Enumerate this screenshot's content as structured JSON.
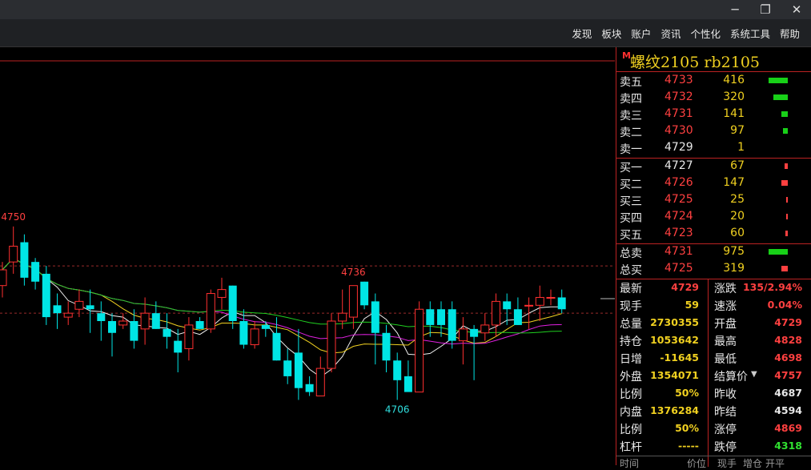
{
  "window": {
    "min_icon": "─",
    "restore_icon": "❐",
    "close_icon": "✕"
  },
  "menu": [
    "发现",
    "板块",
    "账户",
    "资讯",
    "个性化",
    "系统工具",
    "帮助"
  ],
  "instrument": {
    "mark": "M",
    "title": "螺纹2105  rb2105"
  },
  "asks": [
    {
      "label": "卖五",
      "price": "4733",
      "vol": "416",
      "bar": 0.85
    },
    {
      "label": "卖四",
      "price": "4732",
      "vol": "320",
      "bar": 0.65
    },
    {
      "label": "卖三",
      "price": "4731",
      "vol": "141",
      "bar": 0.28
    },
    {
      "label": "卖二",
      "price": "4730",
      "vol": "97",
      "bar": 0.2
    },
    {
      "label": "卖一",
      "price": "4729",
      "vol": "1",
      "bar": 0.0
    }
  ],
  "bids": [
    {
      "label": "买一",
      "price": "4727",
      "vol": "67",
      "bar": 0.14
    },
    {
      "label": "买二",
      "price": "4726",
      "vol": "147",
      "bar": 0.3
    },
    {
      "label": "买三",
      "price": "4725",
      "vol": "25",
      "bar": 0.05
    },
    {
      "label": "买四",
      "price": "4724",
      "vol": "20",
      "bar": 0.04
    },
    {
      "label": "买五",
      "price": "4723",
      "vol": "60",
      "bar": 0.12
    }
  ],
  "totals": [
    {
      "label": "总卖",
      "price": "4731",
      "vol": "975",
      "bar": 0.85,
      "color": "#18d018"
    },
    {
      "label": "总买",
      "price": "4725",
      "vol": "319",
      "bar": 0.28,
      "color": "#ff4040"
    }
  ],
  "stats_left": [
    {
      "label": "最新",
      "value": "4729",
      "color": "#ff4040"
    },
    {
      "label": "现手",
      "value": "59",
      "color": "#f0d020"
    },
    {
      "label": "总量",
      "value": "2730355",
      "color": "#f0d020"
    },
    {
      "label": "持仓",
      "value": "1053642",
      "color": "#f0d020"
    },
    {
      "label": "日增",
      "value": "-11645",
      "color": "#f0d020"
    },
    {
      "label": "外盘",
      "value": "1354071",
      "color": "#f0d020"
    },
    {
      "label": "比例",
      "value": "50%",
      "color": "#f0d020"
    },
    {
      "label": "内盘",
      "value": "1376284",
      "color": "#f0d020"
    },
    {
      "label": "比例",
      "value": "50%",
      "color": "#f0d020"
    },
    {
      "label": "杠杆",
      "value": "-----",
      "color": "#f0d020"
    }
  ],
  "stats_right": [
    {
      "label": "涨跌",
      "value": "135/2.94%",
      "color": "#ff4040"
    },
    {
      "label": "速涨",
      "value": "0.04%",
      "color": "#ff4040"
    },
    {
      "label": "开盘",
      "value": "4729",
      "color": "#ff4040"
    },
    {
      "label": "最高",
      "value": "4828",
      "color": "#ff4040"
    },
    {
      "label": "最低",
      "value": "4698",
      "color": "#ff4040"
    },
    {
      "label": "结算价",
      "value": "4757",
      "color": "#ff4040",
      "dropdown": true
    },
    {
      "label": "昨收",
      "value": "4687",
      "color": "#e8e8e8"
    },
    {
      "label": "昨结",
      "value": "4594",
      "color": "#e8e8e8"
    },
    {
      "label": "涨停",
      "value": "4869",
      "color": "#ff4040"
    },
    {
      "label": "跌停",
      "value": "4318",
      "color": "#30e030"
    }
  ],
  "bottom_header": [
    "时间",
    "价位",
    "现手",
    "增仓",
    "开平"
  ],
  "chart_data": {
    "type": "candlestick",
    "annotations": [
      {
        "text": "4750",
        "index": 1,
        "price": 4750,
        "color": "#ff4040"
      },
      {
        "text": "4736",
        "index": 32,
        "price": 4736,
        "color": "#ff4040"
      },
      {
        "text": "4706",
        "index": 36,
        "price": 4706,
        "color": "#30e0e0"
      }
    ],
    "ref_lines": [
      4740,
      4728
    ],
    "ylim": [
      4700,
      4765
    ],
    "candles": [
      [
        4735,
        4741,
        4732,
        4739
      ],
      [
        4741,
        4750,
        4738,
        4745
      ],
      [
        4746,
        4748,
        4735,
        4737
      ],
      [
        4741,
        4742,
        4734,
        4736
      ],
      [
        4738,
        4740,
        4725,
        4727
      ],
      [
        4730,
        4733,
        4724,
        4728
      ],
      [
        4727,
        4731,
        4725,
        4728
      ],
      [
        4729,
        4734,
        4727,
        4731
      ],
      [
        4730,
        4734,
        4723,
        4729
      ],
      [
        4728,
        4731,
        4721,
        4726
      ],
      [
        4726,
        4728,
        4717,
        4723
      ],
      [
        4725,
        4728,
        4724,
        4726
      ],
      [
        4726,
        4729,
        4719,
        4721
      ],
      [
        4724,
        4732,
        4720,
        4728
      ],
      [
        4728,
        4731,
        4724,
        4724
      ],
      [
        4724,
        4728,
        4719,
        4722
      ],
      [
        4721,
        4724,
        4713,
        4718
      ],
      [
        4719,
        4727,
        4716,
        4725
      ],
      [
        4726,
        4727,
        4724,
        4724
      ],
      [
        4724,
        4734,
        4723,
        4733
      ],
      [
        4732,
        4737,
        4729,
        4734
      ],
      [
        4735,
        4735,
        4724,
        4726
      ],
      [
        4726,
        4729,
        4719,
        4720
      ],
      [
        4720,
        4726,
        4719,
        4724
      ],
      [
        4725,
        4726,
        4722,
        4724
      ],
      [
        4723,
        4727,
        4716,
        4716
      ],
      [
        4716,
        4719,
        4710,
        4712
      ],
      [
        4718,
        4724,
        4706,
        4709
      ],
      [
        4710,
        4712,
        4707,
        4708
      ],
      [
        4707,
        4717,
        4707,
        4714
      ],
      [
        4714,
        4728,
        4713,
        4726
      ],
      [
        4726,
        4734,
        4724,
        4728
      ],
      [
        4727,
        4733,
        4724,
        4735
      ],
      [
        4736,
        4736,
        4729,
        4730
      ],
      [
        4731,
        4733,
        4715,
        4723
      ],
      [
        4723,
        4725,
        4713,
        4716
      ],
      [
        4716,
        4718,
        4706,
        4711
      ],
      [
        4712,
        4716,
        4710,
        4708
      ],
      [
        4708,
        4731,
        4708,
        4729
      ],
      [
        4729,
        4731,
        4722,
        4725
      ],
      [
        4729,
        4731,
        4722,
        4725
      ],
      [
        4729,
        4731,
        4719,
        4721
      ],
      [
        4721,
        4727,
        4715,
        4724
      ],
      [
        4724,
        4725,
        4711,
        4722
      ],
      [
        4723,
        4728,
        4721,
        4725
      ],
      [
        4725,
        4733,
        4722,
        4731
      ],
      [
        4731,
        4733,
        4725,
        4729
      ],
      [
        4729,
        4732,
        4725,
        4725
      ],
      [
        4730,
        4732,
        4724,
        4730
      ],
      [
        4730,
        4735,
        4726,
        4732
      ],
      [
        4732,
        4734,
        4730,
        4732
      ],
      [
        4732,
        4734,
        4728,
        4729
      ]
    ]
  }
}
